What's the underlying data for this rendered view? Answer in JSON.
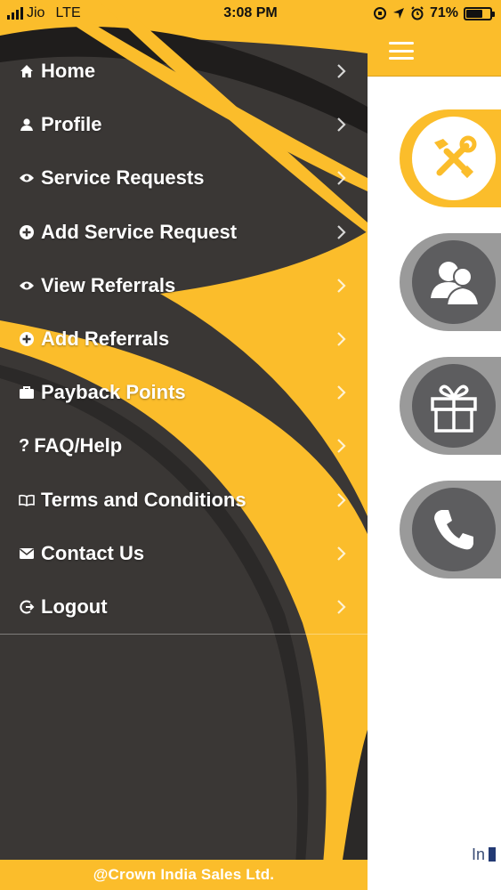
{
  "status_bar": {
    "carrier": "Jio",
    "network": "LTE",
    "time": "3:08 PM",
    "battery": "71%",
    "battery_level": 0.71
  },
  "drawer": {
    "menu": [
      {
        "label": "Home",
        "icon": "home-icon"
      },
      {
        "label": "Profile",
        "icon": "person-icon"
      },
      {
        "label": "Service Requests",
        "icon": "eye-icon"
      },
      {
        "label": "Add Service Request",
        "icon": "plus-circle-icon"
      },
      {
        "label": "View Referrals",
        "icon": "eye-icon"
      },
      {
        "label": "Add Referrals",
        "icon": "plus-circle-icon"
      },
      {
        "label": "Payback Points",
        "icon": "briefcase-icon"
      },
      {
        "label": "FAQ/Help",
        "icon": "question-icon"
      },
      {
        "label": "Terms and Conditions",
        "icon": "book-icon"
      },
      {
        "label": "Contact Us",
        "icon": "envelope-icon"
      },
      {
        "label": "Logout",
        "icon": "logout-icon"
      }
    ],
    "footer": "@Crown India Sales Ltd."
  },
  "main": {
    "tiles": [
      {
        "icon": "tools-icon"
      },
      {
        "icon": "users-icon"
      },
      {
        "icon": "gift-icon"
      },
      {
        "icon": "phone-icon"
      }
    ],
    "bottom_text": "In"
  },
  "colors": {
    "accent": "#fbbd2b",
    "drawer_dark": "#3a3735",
    "tile_grey": "#9a9a9a",
    "circle_dark": "#5d5d5f"
  }
}
